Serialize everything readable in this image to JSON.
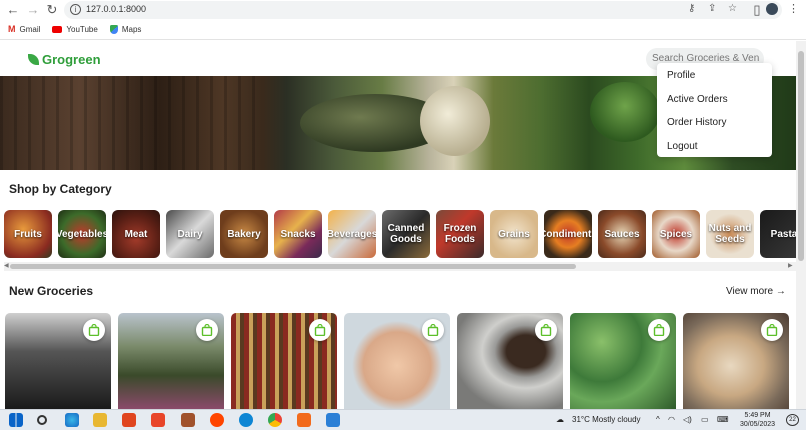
{
  "browser": {
    "url": "127.0.0.1:8000",
    "bookmarks": [
      {
        "label": "Gmail",
        "icon": "gmail-icon"
      },
      {
        "label": "YouTube",
        "icon": "youtube-icon"
      },
      {
        "label": "Maps",
        "icon": "maps-icon"
      }
    ]
  },
  "header": {
    "brand": "Grogreen",
    "search_placeholder": "Search Groceries & Ven"
  },
  "user_menu": [
    "Profile",
    "Active Orders",
    "Order History",
    "Logout"
  ],
  "banner": {
    "slide_count": 6,
    "active_slide": 1
  },
  "categories": {
    "title": "Shop by Category",
    "items": [
      "Fruits",
      "Vegetables",
      "Meat",
      "Dairy",
      "Bakery",
      "Snacks",
      "Beverages",
      "Canned Goods",
      "Frozen Foods",
      "Grains",
      "Condiments",
      "Sauces",
      "Spices",
      "Nuts and Seeds",
      "Pasta"
    ]
  },
  "new_groceries": {
    "title": "New Groceries",
    "view_more": "View more →",
    "items": [
      "eiffel-tower-photo",
      "hillside-town-photo",
      "market-shelf-photo",
      "baby-eating-photo",
      "spice-tin-photo",
      "cabbages-photo",
      "bread-loaf-photo"
    ]
  },
  "taskbar": {
    "weather": "31°C  Mostly cloudy",
    "time": "5:49 PM",
    "date": "30/05/2023",
    "notifications": "22"
  },
  "colors": {
    "brand_green": "#2f9e3a",
    "cart_icon_green": "#5cbf2a"
  }
}
